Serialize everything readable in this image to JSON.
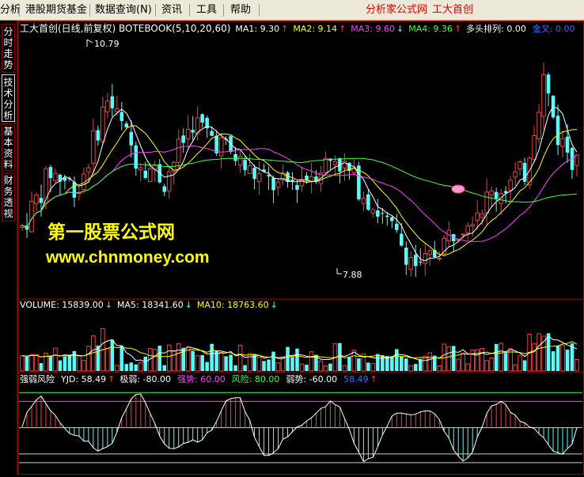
{
  "menu": {
    "items": [
      "分析",
      "港股期货基金",
      "数据查询(N)",
      "资讯",
      "工具",
      "帮助"
    ],
    "right_items": [
      "分析家公式网",
      "工大首创"
    ]
  },
  "side_tabs": [
    "分时走势",
    "技术分析",
    "基本资料",
    "财务透视"
  ],
  "active_tab": 1,
  "main_panel": {
    "title": "工大首创(日线,前复权) BOTEBOOK(5,10,20,60)",
    "indicators": [
      {
        "label": "MA1: 9.30",
        "color": "#ffffff",
        "arrow": "up"
      },
      {
        "label": "MA2: 9.14",
        "color": "#ffff00",
        "arrow": "up"
      },
      {
        "label": "MA3: 9.60",
        "color": "#ff40ff",
        "arrow": "down"
      },
      {
        "label": "MA4: 9.36",
        "color": "#40ff40",
        "arrow": "up"
      },
      {
        "label": "多头排列: 0.00",
        "color": "#ffffff",
        "arrow": ""
      },
      {
        "label": "金叉: 0.00",
        "color": "#3070ff",
        "arrow": ""
      }
    ],
    "high_label": "10.79",
    "low_label": "7.88"
  },
  "volume_panel": {
    "indicators": [
      {
        "label": "VOLUME: 15839.00",
        "color": "#ffffff",
        "arrow": "down"
      },
      {
        "label": "MA5: 18341.60",
        "color": "#ffffff",
        "arrow": "down"
      },
      {
        "label": "MA10: 18763.60",
        "color": "#ffff00",
        "arrow": "down"
      }
    ]
  },
  "osc_panel": {
    "indicators": [
      {
        "label": "强弱风险",
        "color": "#ffffff",
        "arrow": ""
      },
      {
        "label": "YJD: 58.49",
        "color": "#ffffff",
        "arrow": "up"
      },
      {
        "label": "极弱: -80.00",
        "color": "#ffffff",
        "arrow": ""
      },
      {
        "label": "强势: 60.00",
        "color": "#ff40ff",
        "arrow": ""
      },
      {
        "label": "风险: 80.00",
        "color": "#40ff40",
        "arrow": ""
      },
      {
        "label": "弱势: -60.00",
        "color": "#ffffff",
        "arrow": ""
      },
      {
        "label": "58.49",
        "color": "#3070ff",
        "arrow": "up"
      }
    ]
  },
  "watermark": {
    "name": "第一股票公式网",
    "url": "www.chnmoney.com"
  },
  "colors": {
    "up": "#ff3b3b",
    "down": "#54ffff",
    "frame": "#b00000",
    "ma5": "#ffffff",
    "ma10": "#ffff00",
    "ma20": "#ff40ff",
    "ma60": "#40ff40"
  }
}
